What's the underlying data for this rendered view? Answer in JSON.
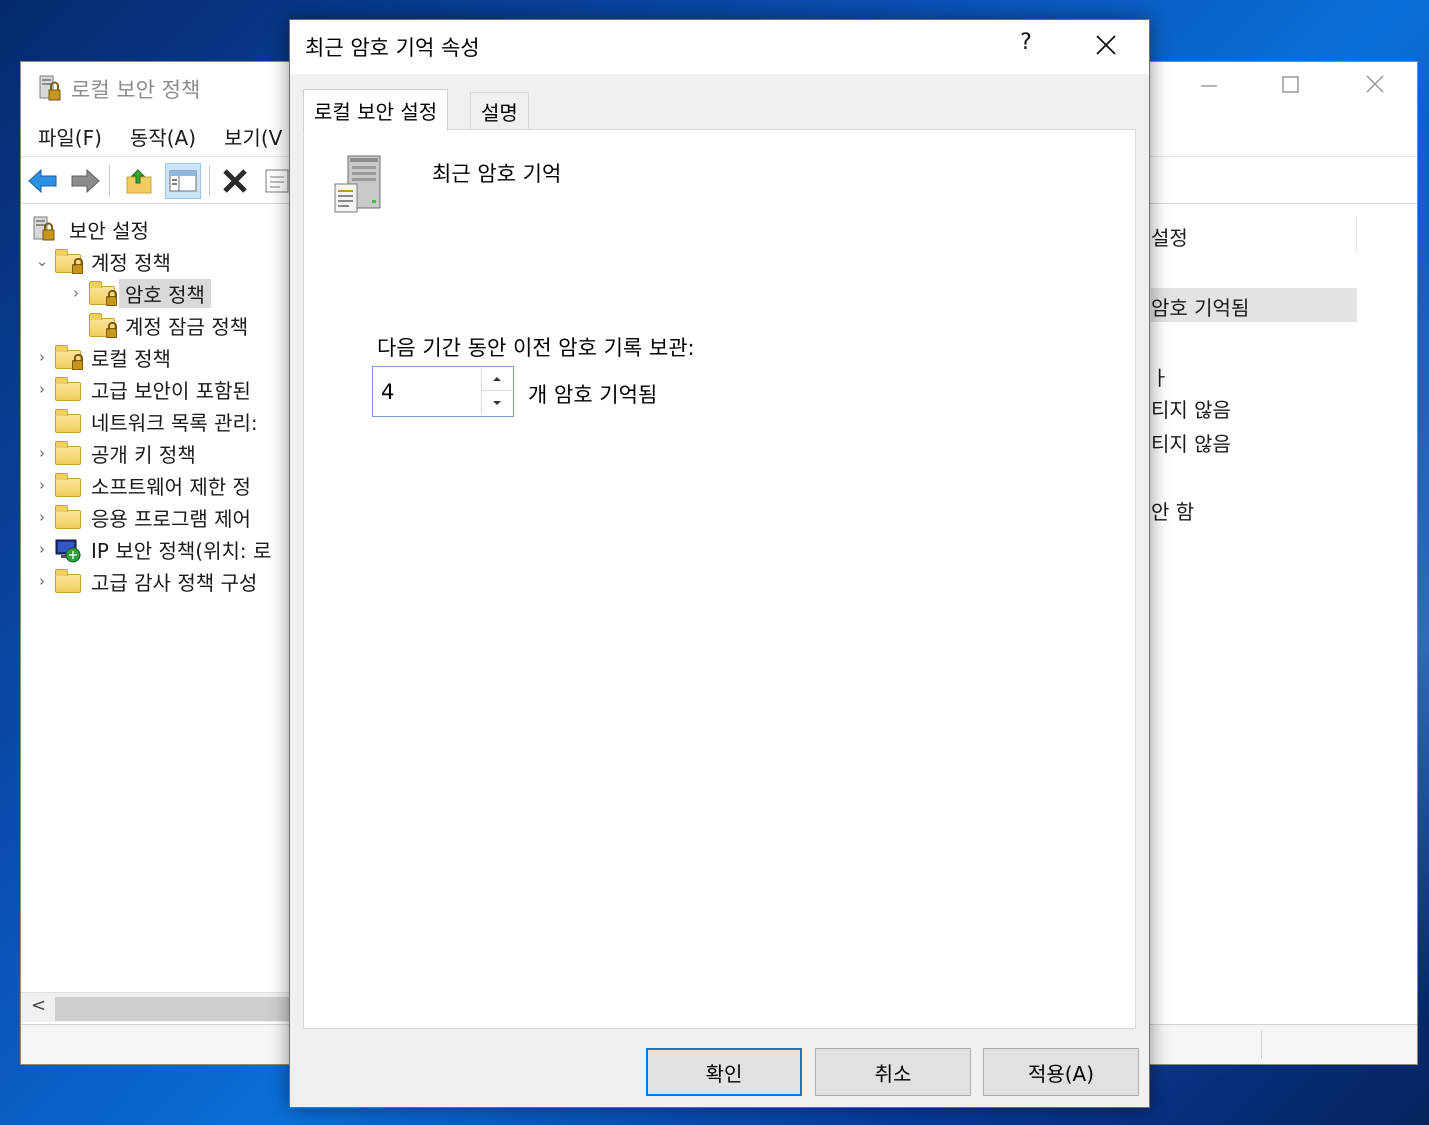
{
  "main_window": {
    "title": "로컬 보안 정책",
    "menu": [
      "파일(F)",
      "동작(A)",
      "보기(V"
    ],
    "tree": [
      {
        "label": "보안 설정",
        "indent": 0,
        "expander": ""
      },
      {
        "label": "계정 정책",
        "indent": 1,
        "expander": "⌄"
      },
      {
        "label": "암호 정책",
        "indent": 2,
        "expander": "›",
        "selected": true
      },
      {
        "label": "계정 잠금 정책",
        "indent": 2,
        "expander": ""
      },
      {
        "label": "로컬 정책",
        "indent": 1,
        "expander": "›"
      },
      {
        "label": "고급 보안이 포함된",
        "indent": 1,
        "expander": "›"
      },
      {
        "label": "네트워크 목록 관리:",
        "indent": 1,
        "expander": ""
      },
      {
        "label": "공개 키 정책",
        "indent": 1,
        "expander": "›"
      },
      {
        "label": "소프트웨어 제한 정",
        "indent": 1,
        "expander": "›"
      },
      {
        "label": "응용 프로그램 제어",
        "indent": 1,
        "expander": "›"
      },
      {
        "label": "IP 보안 정책(위치: 로",
        "indent": 1,
        "expander": "›"
      },
      {
        "label": "고급 감사 정책 구성",
        "indent": 1,
        "expander": "›"
      }
    ],
    "right_pane": {
      "column_header": "설정",
      "rows": [
        "암호 기억됨",
        "ㅏ",
        "티지 않음",
        "티지 않음",
        "안 함"
      ]
    },
    "scroll_left": "<"
  },
  "dialog": {
    "title": "최근 암호 기억 속성",
    "help": "?",
    "tabs": [
      "로컬 보안 설정",
      "설명"
    ],
    "policy_name": "최근 암호 기억",
    "retain_label": "다음 기간 동안 이전 암호 기록 보관:",
    "spin_value": "4",
    "spin_suffix": "개 암호 기억됨",
    "buttons": {
      "ok": "확인",
      "cancel": "취소",
      "apply": "적용(A)"
    }
  },
  "colors": {
    "accent": "#0078d7",
    "dialog_bg": "#f0f0f0",
    "desktop": "#0a4fb3"
  }
}
